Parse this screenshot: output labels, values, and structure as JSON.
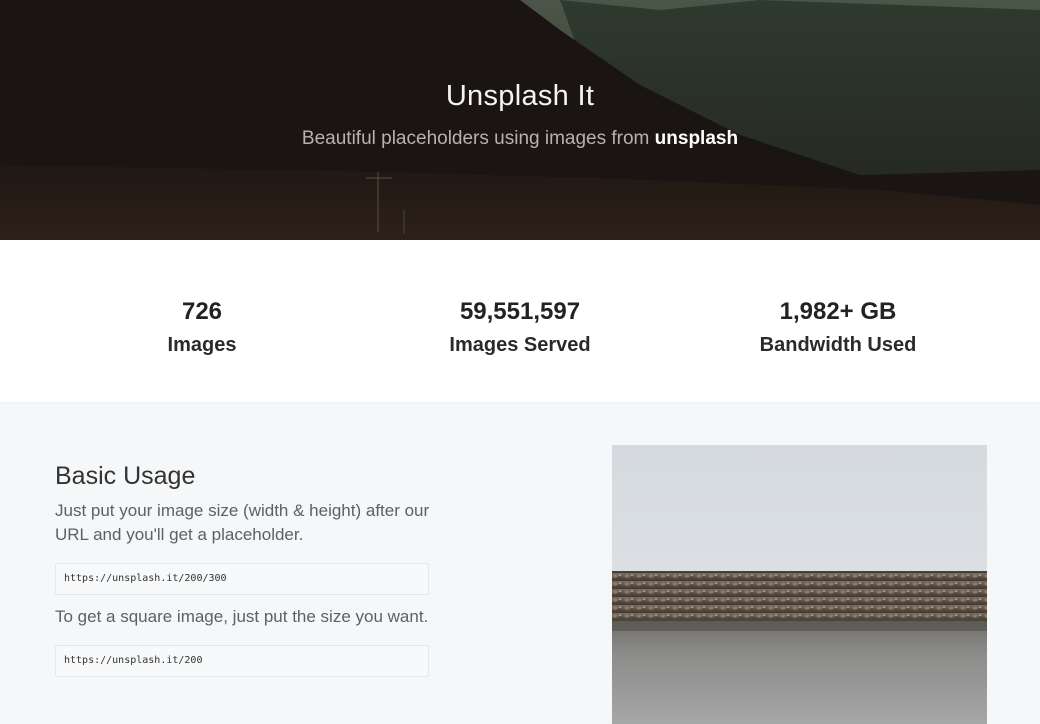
{
  "hero": {
    "title": "Unsplash It",
    "subtitle_prefix": "Beautiful placeholders using images from ",
    "subtitle_link": "unsplash"
  },
  "stats": [
    {
      "value": "726",
      "label": "Images"
    },
    {
      "value": "59,551,597",
      "label": "Images Served"
    },
    {
      "value": "1,982+ GB",
      "label": "Bandwidth Used"
    }
  ],
  "basic_usage": {
    "title": "Basic Usage",
    "description": "Just put your image size (width & height) after our URL and you'll get a placeholder.",
    "example_url": "https://unsplash.it/200/300",
    "square_description": "To get a square image, just put the size you want.",
    "square_url": "https://unsplash.it/200"
  },
  "colors": {
    "hero_dark": "#1d1716",
    "mountain_green": "#3a4438",
    "page_background": "#f5f7f8",
    "stats_background": "#ffffff"
  }
}
